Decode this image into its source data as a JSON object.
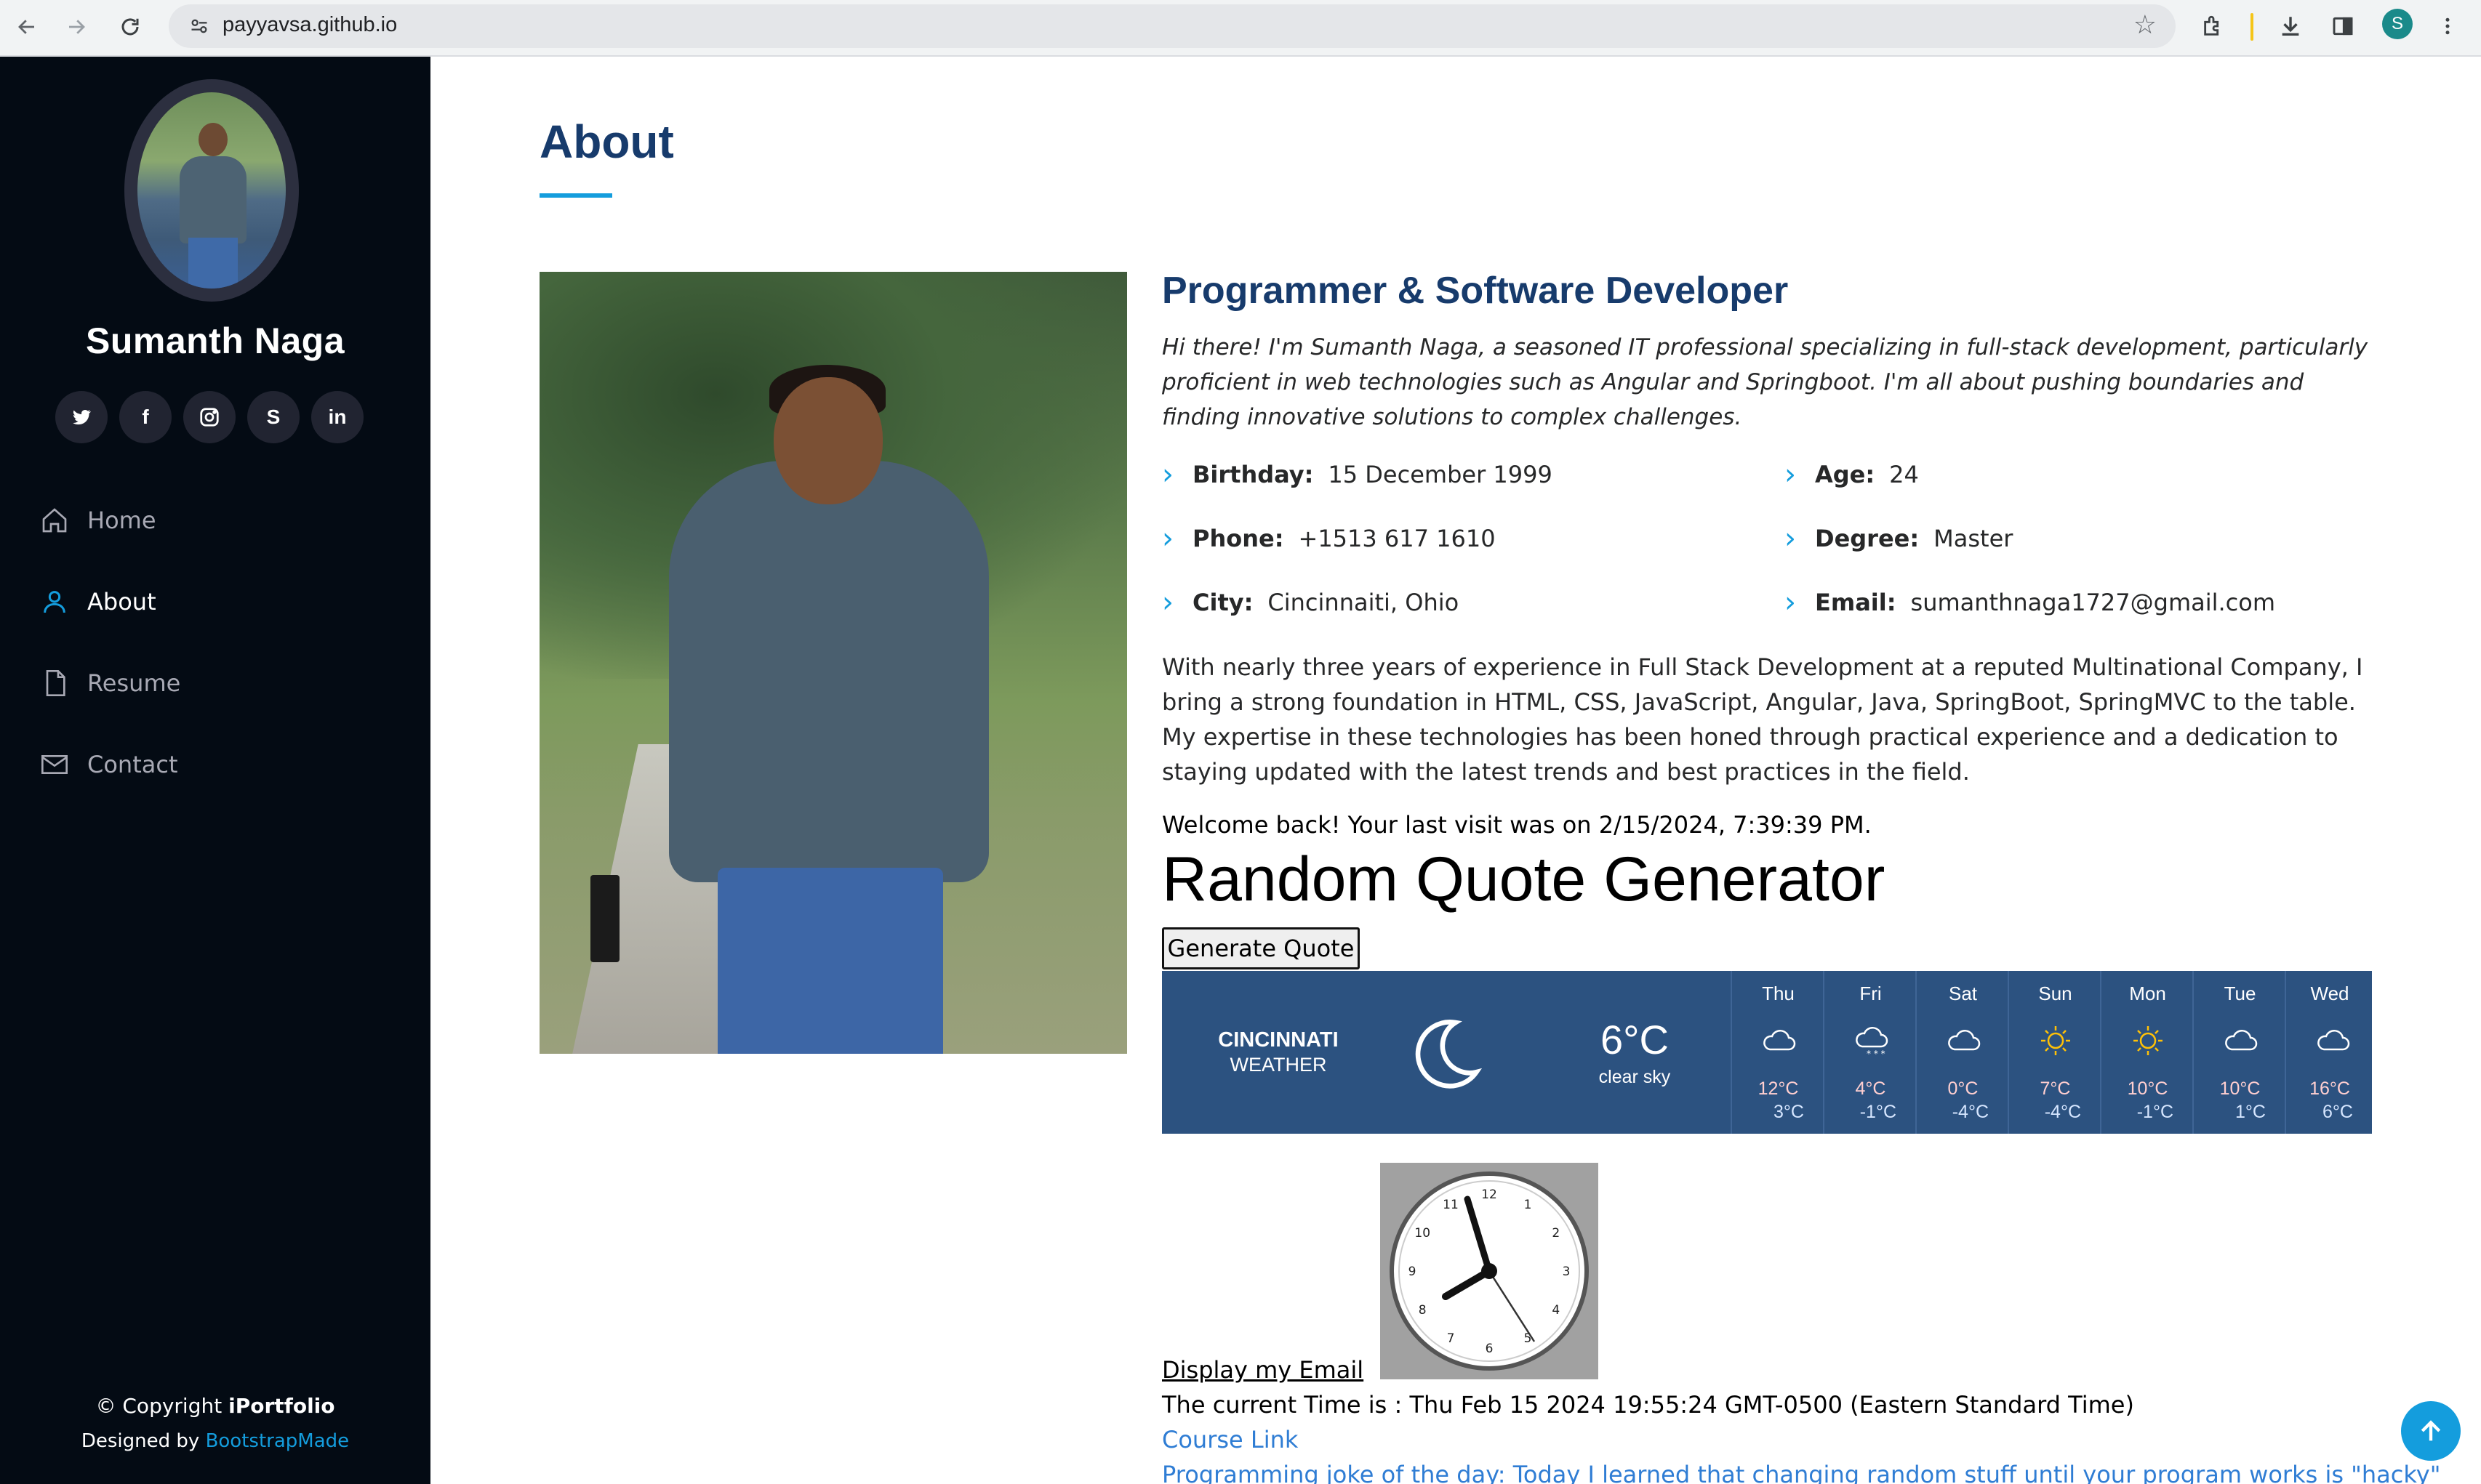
{
  "browser": {
    "url": "payyavsa.github.io",
    "profile_initial": "S"
  },
  "sidebar": {
    "name": "Sumanth Naga",
    "social": [
      {
        "icon": "twitter-icon"
      },
      {
        "icon": "facebook-icon",
        "glyph": "f"
      },
      {
        "icon": "instagram-icon"
      },
      {
        "icon": "skype-icon",
        "glyph": "S"
      },
      {
        "icon": "linkedin-icon",
        "glyph": "in"
      }
    ],
    "nav": [
      {
        "label": "Home",
        "icon": "home-icon"
      },
      {
        "label": "About",
        "icon": "user-icon",
        "active": true
      },
      {
        "label": "Resume",
        "icon": "file-icon"
      },
      {
        "label": "Contact",
        "icon": "envelope-icon"
      }
    ],
    "copyright_prefix": "© Copyright ",
    "copyright_brand": "iPortfolio",
    "designed_by_prefix": "Designed by ",
    "designed_by_link": "BootstrapMade"
  },
  "about": {
    "section_title": "About",
    "subtitle": "Programmer & Software Developer",
    "intro": "Hi there! I'm Sumanth Naga, a seasoned IT professional specializing in full-stack development, particularly proficient in web technologies such as Angular and Springboot. I'm all about pushing boundaries and finding innovative solutions to complex challenges.",
    "facts": {
      "birthday": {
        "label": "Birthday:",
        "value": "15 December 1999"
      },
      "age": {
        "label": "Age:",
        "value": "24"
      },
      "phone": {
        "label": "Phone:",
        "value": "+1513 617 1610"
      },
      "degree": {
        "label": "Degree:",
        "value": "Master"
      },
      "city": {
        "label": "City:",
        "value": "Cincinnaiti, Ohio"
      },
      "email": {
        "label": "Email:",
        "value": "sumanthnaga1727@gmail.com"
      }
    },
    "description": "With nearly three years of experience in Full Stack Development at a reputed Multinational Company, I bring a strong foundation in HTML, CSS, JavaScript, Angular, Java, SpringBoot, SpringMVC to the table. My expertise in these technologies has been honed through practical experience and a dedication to staying updated with the latest trends and best practices in the field.",
    "last_visit": "Welcome back! Your last visit was on 2/15/2024, 7:39:39 PM.",
    "quote_title": "Random Quote Generator",
    "quote_button": "Generate Quote",
    "display_email_link": "Display my Email",
    "current_time": "The current Time is : Thu Feb 15 2024 19:55:24 GMT-0500 (Eastern Standard Time)",
    "course_link": "Course Link",
    "joke": "Programming joke of the day: Today I learned that changing random stuff until your program works is \"hacky\""
  },
  "weather": {
    "city": "CINCINNATI",
    "label": "WEATHER",
    "current_icon": "moon-icon",
    "temp": "6°C",
    "condition": "clear sky",
    "days": [
      {
        "day": "Thu",
        "icon": "cloud-icon",
        "hi": "12°C",
        "lo": "3°C"
      },
      {
        "day": "Fri",
        "icon": "snow-cloud-icon",
        "hi": "4°C",
        "lo": "-1°C"
      },
      {
        "day": "Sat",
        "icon": "cloud-icon",
        "hi": "0°C",
        "lo": "-4°C"
      },
      {
        "day": "Sun",
        "icon": "sun-icon",
        "hi": "7°C",
        "lo": "-4°C"
      },
      {
        "day": "Mon",
        "icon": "sun-icon",
        "hi": "10°C",
        "lo": "-1°C"
      },
      {
        "day": "Tue",
        "icon": "cloud-icon",
        "hi": "10°C",
        "lo": "1°C"
      },
      {
        "day": "Wed",
        "icon": "cloud-icon",
        "hi": "16°C",
        "lo": "6°C"
      }
    ]
  },
  "clock": {
    "time": "7:55:24",
    "numerals": [
      "12",
      "1",
      "2",
      "3",
      "4",
      "5",
      "6",
      "7",
      "8",
      "9",
      "10",
      "11"
    ]
  },
  "colors": {
    "accent": "#149ddd",
    "heading": "#173b6c",
    "sidebar_bg": "#040b14",
    "weather_bg": "#2c5280"
  }
}
